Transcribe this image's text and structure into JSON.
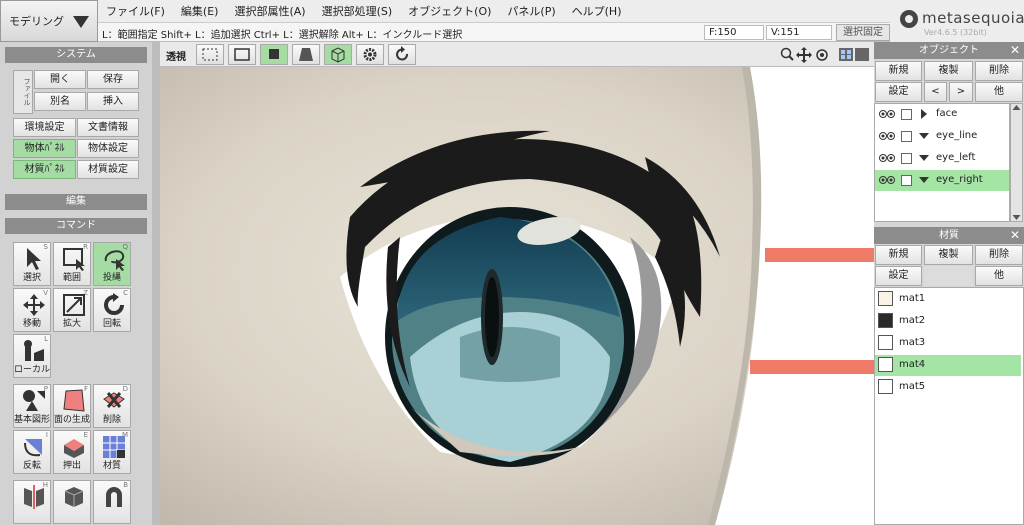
{
  "toolbar": {
    "mode_label": "モデリング",
    "menu": [
      "ファイル(F)",
      "編集(E)",
      "選択部属性(A)",
      "選択部処理(S)",
      "オブジェクト(O)",
      "パネル(P)",
      "ヘルプ(H)"
    ],
    "hint": "L：範囲指定  Shift+ L：追加選択  Ctrl+ L：選択解除  Alt+ L：インクルード選択",
    "face_count": "F:150",
    "vertex_count": "V:151",
    "select_setting": "選択固定"
  },
  "logo": {
    "name": "metasequoia4",
    "version": "Ver4.6.5 (32bit)"
  },
  "system_panel": {
    "title": "システム",
    "file_label": "ファイル",
    "open": "開く",
    "save": "保存",
    "saveas": "別名",
    "insert": "挿入",
    "env": "環境設定",
    "docinfo": "文書情報",
    "obj_panel": "物体ﾊﾟﾈﾙ",
    "obj_setting": "物体設定",
    "mat_panel": "材質ﾊﾟﾈﾙ",
    "mat_setting": "材質設定"
  },
  "edit_panel": {
    "title": "編集"
  },
  "command_panel": {
    "title": "コマンド",
    "tools": [
      {
        "label": "選択",
        "key": "S"
      },
      {
        "label": "範囲",
        "key": "R"
      },
      {
        "label": "投縄",
        "key": "Q"
      },
      {
        "label": "移動",
        "key": "V"
      },
      {
        "label": "拡大",
        "key": "Z"
      },
      {
        "label": "回転",
        "key": "C"
      },
      {
        "label": "ローカル",
        "key": "L"
      },
      {
        "label": "基本図形",
        "key": "P"
      },
      {
        "label": "面の生成",
        "key": "F"
      },
      {
        "label": "削除",
        "key": "D"
      },
      {
        "label": "反転",
        "key": "I"
      },
      {
        "label": "押出",
        "key": "E"
      },
      {
        "label": "材質",
        "key": "M"
      },
      {
        "label": "",
        "key": "H"
      },
      {
        "label": "",
        "key": ""
      },
      {
        "label": "",
        "key": "B"
      }
    ]
  },
  "viewport": {
    "perspective_label": "透視"
  },
  "object_panel": {
    "title": "オブジェクト",
    "new": "新規",
    "dup": "複製",
    "del": "削除",
    "setting": "設定",
    "prev": "<",
    "next": ">",
    "other": "他",
    "objects": [
      {
        "name": "face",
        "selected": false,
        "expanded": false
      },
      {
        "name": "eye_line",
        "selected": false,
        "expanded": true
      },
      {
        "name": "eye_left",
        "selected": false,
        "expanded": true
      },
      {
        "name": "eye_right",
        "selected": true,
        "expanded": true
      }
    ]
  },
  "material_panel": {
    "title": "材質",
    "new": "新規",
    "dup": "複製",
    "del": "削除",
    "setting": "設定",
    "other": "他",
    "materials": [
      {
        "name": "mat1",
        "color": "#fbf3e6",
        "selected": false
      },
      {
        "name": "mat2",
        "color": "#2a2a2a",
        "selected": false
      },
      {
        "name": "mat3",
        "color": "#ffffff",
        "selected": false
      },
      {
        "name": "mat4",
        "color": "#ffffff",
        "selected": true
      },
      {
        "name": "mat5",
        "color": "#ffffff",
        "selected": false
      }
    ]
  },
  "colors": {
    "accent_green": "#a4dca4",
    "panel_header": "#8c8c8c",
    "iris": "#5b8a8e",
    "iris_top": "#1f4f68"
  }
}
